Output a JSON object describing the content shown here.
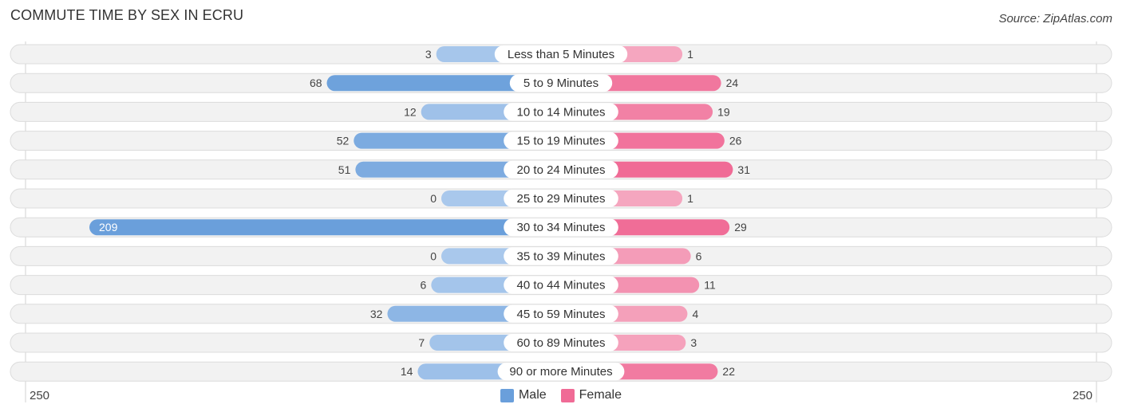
{
  "header": {
    "title": "COMMUTE TIME BY SEX IN ECRU",
    "source": "Source: ZipAtlas.com"
  },
  "colors": {
    "male": "#6a9fdb",
    "male_light": "#a9c8ec",
    "female": "#f06b96",
    "female_light": "#f5a8c0",
    "row_bg": "#f2f2f2",
    "pill_bg": "#ffffff"
  },
  "chart_data": {
    "type": "bar",
    "orientation": "horizontal-diverging",
    "title": "COMMUTE TIME BY SEX IN ECRU",
    "categories": [
      "Less than 5 Minutes",
      "5 to 9 Minutes",
      "10 to 14 Minutes",
      "15 to 19 Minutes",
      "20 to 24 Minutes",
      "25 to 29 Minutes",
      "30 to 34 Minutes",
      "35 to 39 Minutes",
      "40 to 44 Minutes",
      "45 to 59 Minutes",
      "60 to 89 Minutes",
      "90 or more Minutes"
    ],
    "series": [
      {
        "name": "Male",
        "values": [
          3,
          68,
          12,
          52,
          51,
          0,
          209,
          0,
          6,
          32,
          7,
          14
        ]
      },
      {
        "name": "Female",
        "values": [
          1,
          24,
          19,
          26,
          31,
          1,
          29,
          6,
          11,
          4,
          3,
          22
        ]
      }
    ],
    "axis": {
      "left_label": "250",
      "right_label": "250",
      "range": [
        -250,
        250
      ]
    },
    "legend": {
      "position": "bottom-center",
      "entries": [
        "Male",
        "Female"
      ]
    },
    "grid": false
  }
}
